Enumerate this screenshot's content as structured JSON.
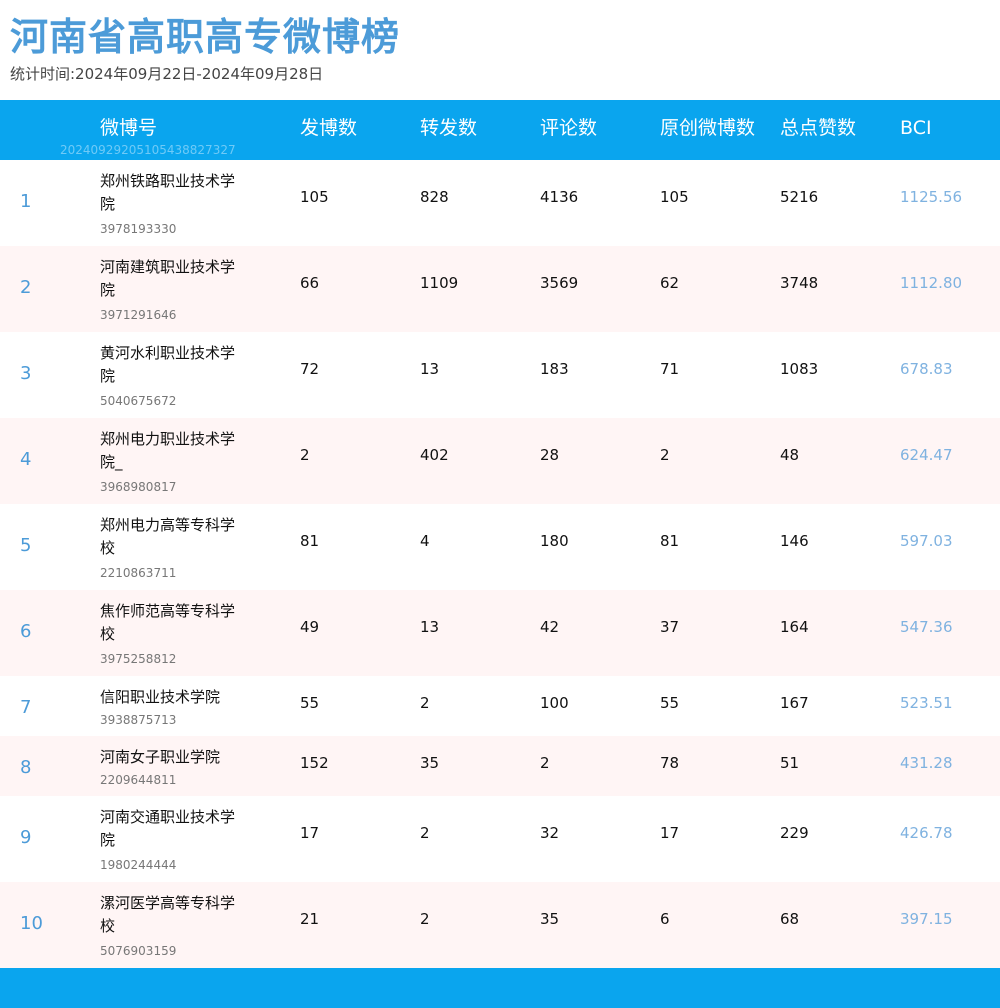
{
  "page": {
    "title": "河南省高职高专微博榜",
    "subtitle": "统计时间:2024年09月22日-2024年09月28日"
  },
  "table": {
    "headers": {
      "account": "微博号",
      "posts": "发博数",
      "reposts": "转发数",
      "comments": "评论数",
      "original": "原创微博数",
      "likes": "总点赞数",
      "bci": "BCI"
    },
    "header_id": "20240929205105438827327",
    "rows": [
      {
        "rank": "1",
        "name": "郑州铁路职业技术学院",
        "uid": "3978193330",
        "posts": "105",
        "reposts": "828",
        "comments": "4136",
        "original": "105",
        "likes": "5216",
        "bci": "1125.56",
        "tall": true
      },
      {
        "rank": "2",
        "name": "河南建筑职业技术学院",
        "uid": "3971291646",
        "posts": "66",
        "reposts": "1109",
        "comments": "3569",
        "original": "62",
        "likes": "3748",
        "bci": "1112.80",
        "tall": true
      },
      {
        "rank": "3",
        "name": "黄河水利职业技术学院",
        "uid": "5040675672",
        "posts": "72",
        "reposts": "13",
        "comments": "183",
        "original": "71",
        "likes": "1083",
        "bci": "678.83",
        "tall": true
      },
      {
        "rank": "4",
        "name": "郑州电力职业技术学院_",
        "uid": "3968980817",
        "posts": "2",
        "reposts": "402",
        "comments": "28",
        "original": "2",
        "likes": "48",
        "bci": "624.47",
        "tall": true
      },
      {
        "rank": "5",
        "name": "郑州电力高等专科学校",
        "uid": "2210863711",
        "posts": "81",
        "reposts": "4",
        "comments": "180",
        "original": "81",
        "likes": "146",
        "bci": "597.03",
        "tall": true
      },
      {
        "rank": "6",
        "name": "焦作师范高等专科学校",
        "uid": "3975258812",
        "posts": "49",
        "reposts": "13",
        "comments": "42",
        "original": "37",
        "likes": "164",
        "bci": "547.36",
        "tall": true
      },
      {
        "rank": "7",
        "name": "信阳职业技术学院",
        "uid": "3938875713",
        "posts": "55",
        "reposts": "2",
        "comments": "100",
        "original": "55",
        "likes": "167",
        "bci": "523.51",
        "tall": false
      },
      {
        "rank": "8",
        "name": "河南女子职业学院",
        "uid": "2209644811",
        "posts": "152",
        "reposts": "35",
        "comments": "2",
        "original": "78",
        "likes": "51",
        "bci": "431.28",
        "tall": false
      },
      {
        "rank": "9",
        "name": "河南交通职业技术学院",
        "uid": "1980244444",
        "posts": "17",
        "reposts": "2",
        "comments": "32",
        "original": "17",
        "likes": "229",
        "bci": "426.78",
        "tall": true
      },
      {
        "rank": "10",
        "name": "漯河医学高等专科学校",
        "uid": "5076903159",
        "posts": "21",
        "reposts": "2",
        "comments": "35",
        "original": "6",
        "likes": "68",
        "bci": "397.15",
        "tall": true
      }
    ]
  },
  "colors": {
    "header_bg": "#0aa5ee",
    "title": "#4c9bd8",
    "rank": "#4c9bd8",
    "bci": "#7fb2e0",
    "row_alt": "#fff5f5"
  }
}
